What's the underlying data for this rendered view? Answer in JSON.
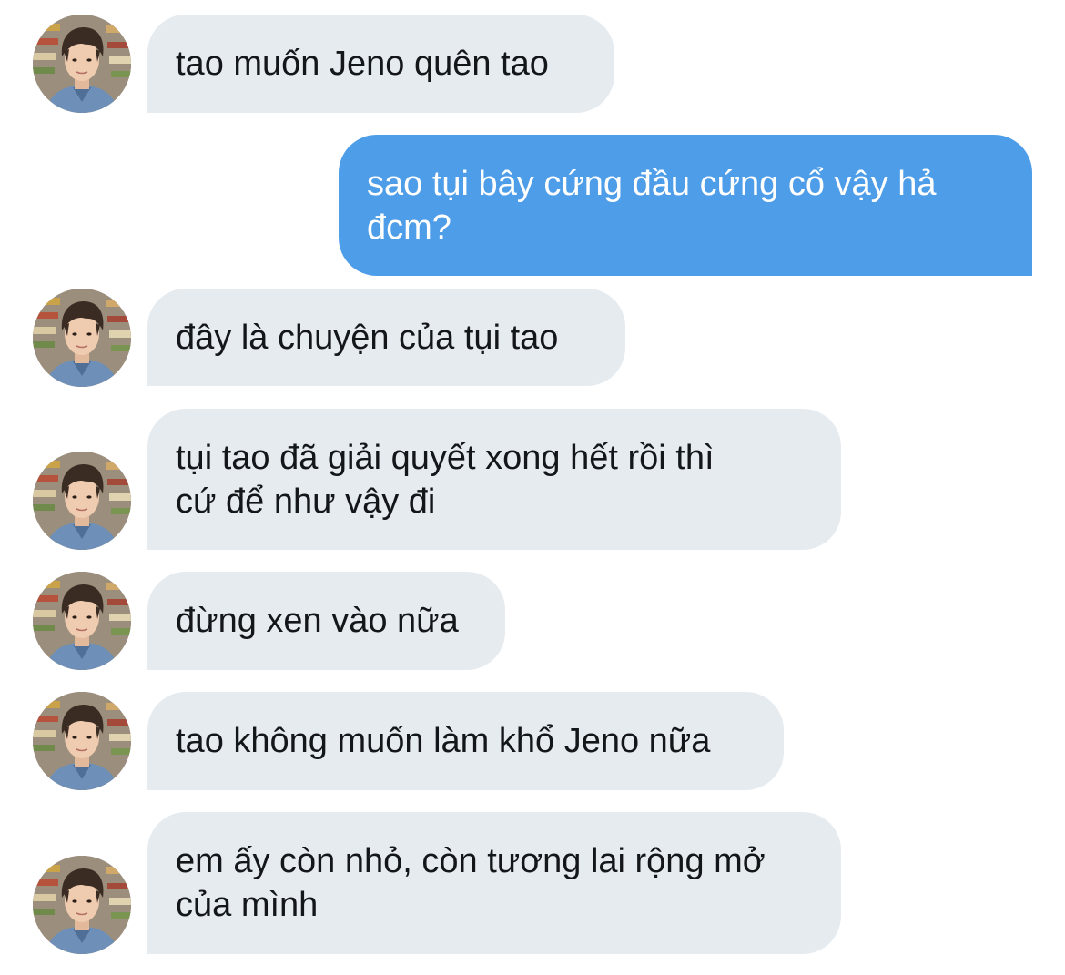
{
  "conversation": {
    "messages": [
      {
        "sender": "them",
        "text": "tao muốn Jeno quên tao"
      },
      {
        "sender": "me",
        "text": "sao tụi bây cứng đầu cứng cổ vậy hả\nđcm?"
      },
      {
        "sender": "them",
        "text": "đây là chuyện của tụi tao"
      },
      {
        "sender": "them",
        "text": "tụi tao đã giải quyết xong hết rồi thì\ncứ để như vậy đi"
      },
      {
        "sender": "them",
        "text": "đừng xen vào nữa"
      },
      {
        "sender": "them",
        "text": "tao không muốn làm khổ Jeno nữa"
      },
      {
        "sender": "them",
        "text": "em ấy còn nhỏ, còn tương lai rộng mở\ncủa mình"
      }
    ]
  },
  "colors": {
    "incoming_bubble": "#e6ebf0",
    "outgoing_bubble": "#4e9de8",
    "incoming_text": "#14171a",
    "outgoing_text": "#ffffff"
  },
  "icons": {
    "avatar": "profile-photo-icon"
  }
}
